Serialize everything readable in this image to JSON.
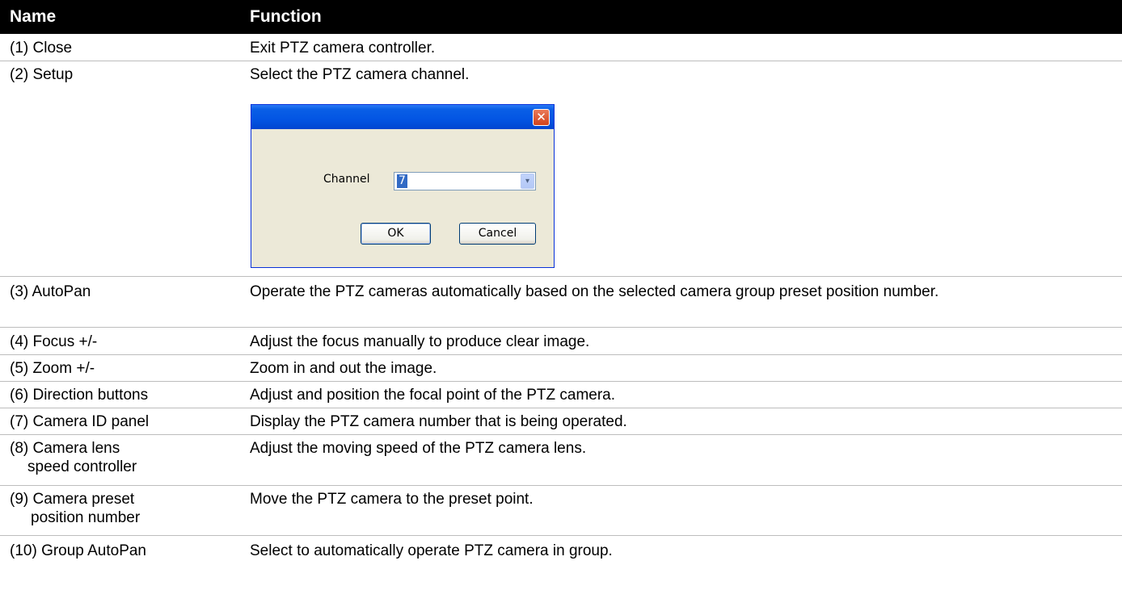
{
  "header": {
    "name": "Name",
    "function": "Function"
  },
  "rows": [
    {
      "name": "(1) Close",
      "function": "Exit PTZ camera controller."
    },
    {
      "name": "(2) Setup",
      "function": "Select the PTZ camera channel."
    },
    {
      "name": "(3) AutoPan",
      "function": "Operate the PTZ cameras automatically based on the selected camera group preset position number."
    },
    {
      "name": "(4) Focus +/-",
      "function": "Adjust the focus manually to produce clear image."
    },
    {
      "name": "(5) Zoom +/-",
      "function": "Zoom in and out the image."
    },
    {
      "name": "(6) Direction buttons",
      "function": "Adjust and position the focal point of the PTZ camera."
    },
    {
      "name": "(7) Camera ID panel",
      "function": "Display the PTZ camera number that is being operated."
    },
    {
      "name_line1": "(8) Camera lens",
      "name_line2": "speed controller",
      "function": "Adjust the moving speed of the PTZ camera lens."
    },
    {
      "name_line1": "(9) Camera preset",
      "name_line2": "position number",
      "function": "Move the PTZ camera to the preset point."
    },
    {
      "name": "(10) Group AutoPan",
      "function": "Select to automatically operate PTZ camera in group."
    }
  ],
  "dialog": {
    "close_glyph": "✕",
    "channel_label": "Channel",
    "channel_value": "7",
    "dropdown_glyph": "▾",
    "ok_label": "OK",
    "cancel_label": "Cancel"
  }
}
